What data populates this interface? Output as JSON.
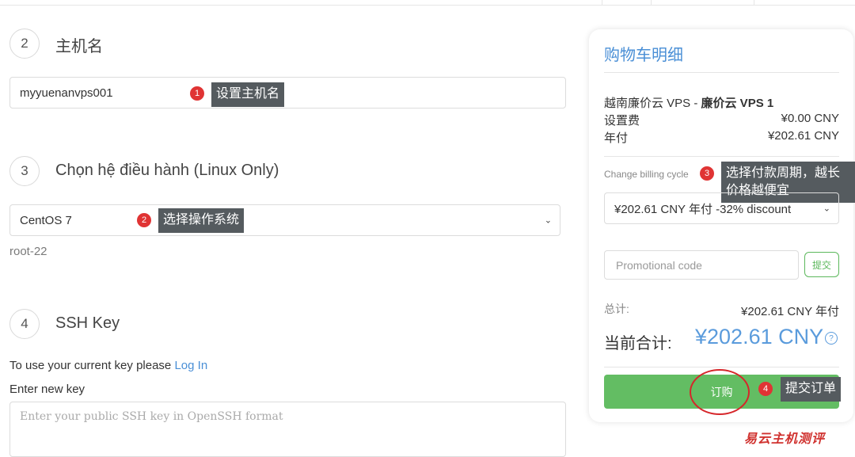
{
  "sections": {
    "hostname": {
      "number": "2",
      "title": "主机名",
      "value": "myyuenanvps001"
    },
    "os": {
      "number": "3",
      "title": "Chọn hệ điều hành (Linux Only)",
      "selected": "CentOS 7",
      "note": "root-22"
    },
    "ssh": {
      "number": "4",
      "title": "SSH Key",
      "login_prompt": "To use your current key please",
      "login_link": "Log In",
      "enter_label": "Enter new key",
      "placeholder": "Enter your public SSH key in OpenSSH format"
    }
  },
  "annotations": [
    {
      "badge": "1",
      "text": "设置主机名"
    },
    {
      "badge": "2",
      "text": "选择操作系统"
    },
    {
      "badge": "3",
      "text": "选择付款周期，越长价格越便宜"
    },
    {
      "badge": "4",
      "text": "提交订单"
    }
  ],
  "cart": {
    "title": "购物车明细",
    "product": "越南廉价云 VPS - ",
    "product_bold": "廉价云 VPS 1",
    "setup_fee_label": "设置费",
    "setup_fee_value": "¥0.00 CNY",
    "annual_label": "年付",
    "annual_value": "¥202.61 CNY",
    "cycle_label": "Change billing cycle",
    "cycle_selected": "¥202.61 CNY 年付 -32% discount",
    "promo_placeholder": "Promotional code",
    "apply_label": "提交",
    "total_label": "总计:",
    "total_value": "¥202.61 CNY  年付",
    "current_label": "当前合计:",
    "current_value": "¥202.61 CNY",
    "help_symbol": "?",
    "order_button": "订购"
  },
  "watermark": "易云主机测评",
  "colors": {
    "accent": "#4a8fd6",
    "order_green": "#63bd63",
    "badge_red": "#e03434",
    "callout_bg": "#555b5f"
  }
}
